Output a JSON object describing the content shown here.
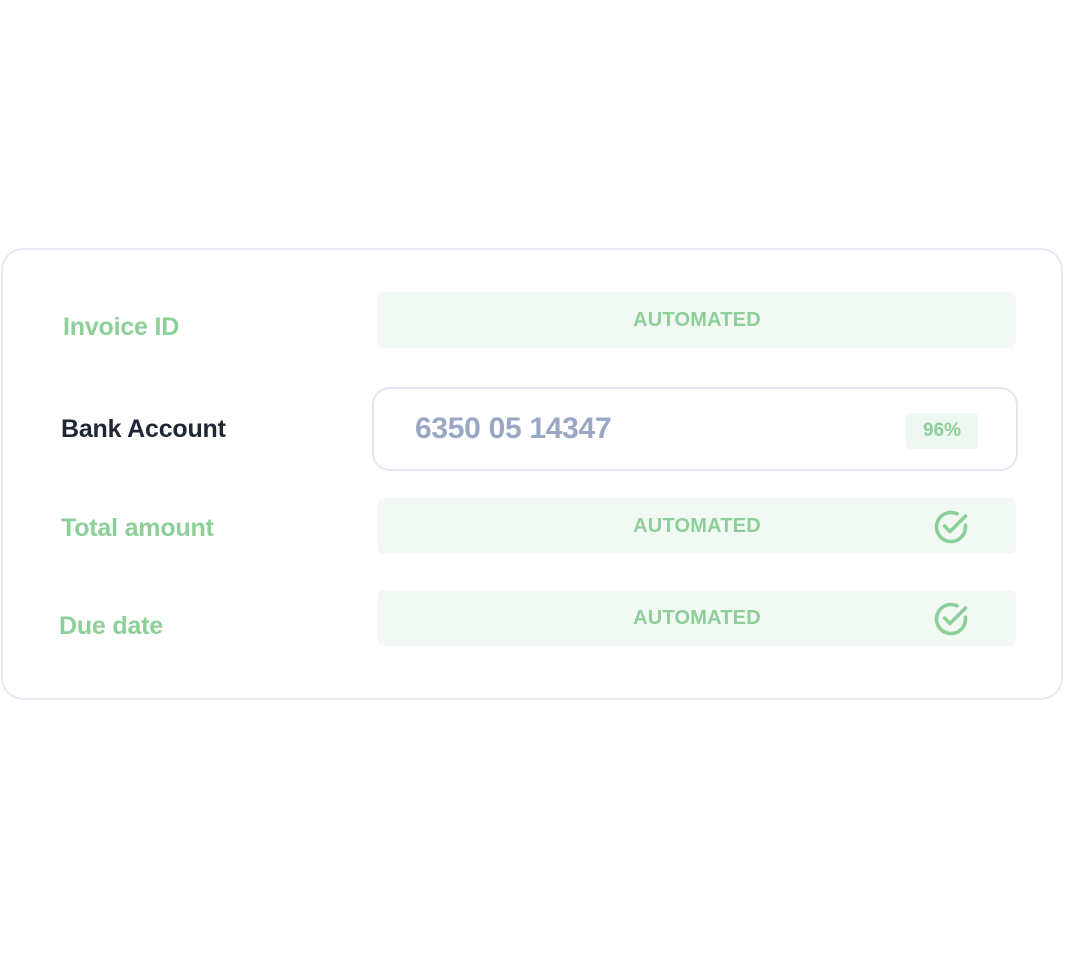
{
  "fields": [
    {
      "label": "Invoice ID",
      "status": "AUTOMATED",
      "verified": false
    },
    {
      "label": "Bank Account",
      "value": "6350 05 14347",
      "confidence": "96%"
    },
    {
      "label": "Total amount",
      "status": "AUTOMATED",
      "verified": true
    },
    {
      "label": "Due date",
      "status": "AUTOMATED",
      "verified": true
    }
  ],
  "colors": {
    "accent_green": "#8ccf98",
    "automated_bg": "#f2f8f4",
    "active_label": "#1f2733",
    "input_value": "#9aa7c4",
    "border": "#e6e9f3"
  },
  "icons": {
    "verified": "check-circle-icon"
  }
}
